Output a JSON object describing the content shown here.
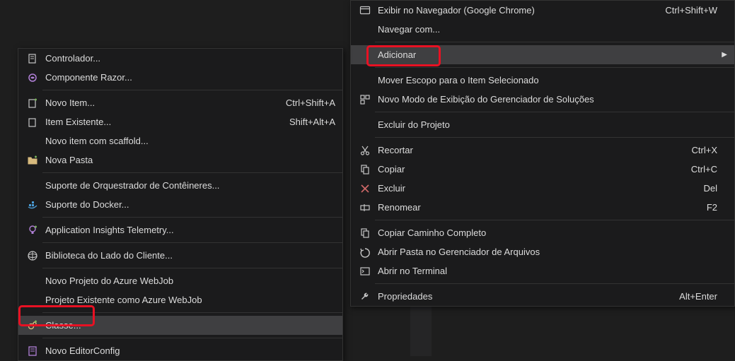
{
  "leftMenu": {
    "controller": "Controlador...",
    "razorComponent": "Componente Razor...",
    "newItem": "Novo Item...",
    "newItemShortcut": "Ctrl+Shift+A",
    "existingItem": "Item Existente...",
    "existingItemShortcut": "Shift+Alt+A",
    "scaffoldItem": "Novo item com scaffold...",
    "newFolder": "Nova Pasta",
    "containerOrchestrator": "Suporte de Orquestrador de Contêineres...",
    "dockerSupport": "Suporte do Docker...",
    "appInsights": "Application Insights Telemetry...",
    "clientLibrary": "Biblioteca do Lado do Cliente...",
    "newAzureWebJob": "Novo Projeto do Azure WebJob",
    "existingAzureWebJob": "Projeto Existente como Azure WebJob",
    "class": "Classe...",
    "newEditorConfig": "Novo EditorConfig"
  },
  "rightMenu": {
    "viewInBrowser": "Exibir no Navegador (Google Chrome)",
    "viewInBrowserShortcut": "Ctrl+Shift+W",
    "browseWith": "Navegar com...",
    "add": "Adicionar",
    "scopeToThis": "Mover Escopo para o Item Selecionado",
    "newSolutionExplorerView": "Novo Modo de Exibição do Gerenciador de Soluções",
    "excludeFromProject": "Excluir do Projeto",
    "cut": "Recortar",
    "cutShortcut": "Ctrl+X",
    "copy": "Copiar",
    "copyShortcut": "Ctrl+C",
    "delete": "Excluir",
    "deleteShortcut": "Del",
    "rename": "Renomear",
    "renameShortcut": "F2",
    "copyFullPath": "Copiar Caminho Completo",
    "openInFileExplorer": "Abrir Pasta no Gerenciador de Arquivos",
    "openInTerminal": "Abrir no Terminal",
    "properties": "Propriedades",
    "propertiesShortcut": "Alt+Enter"
  }
}
